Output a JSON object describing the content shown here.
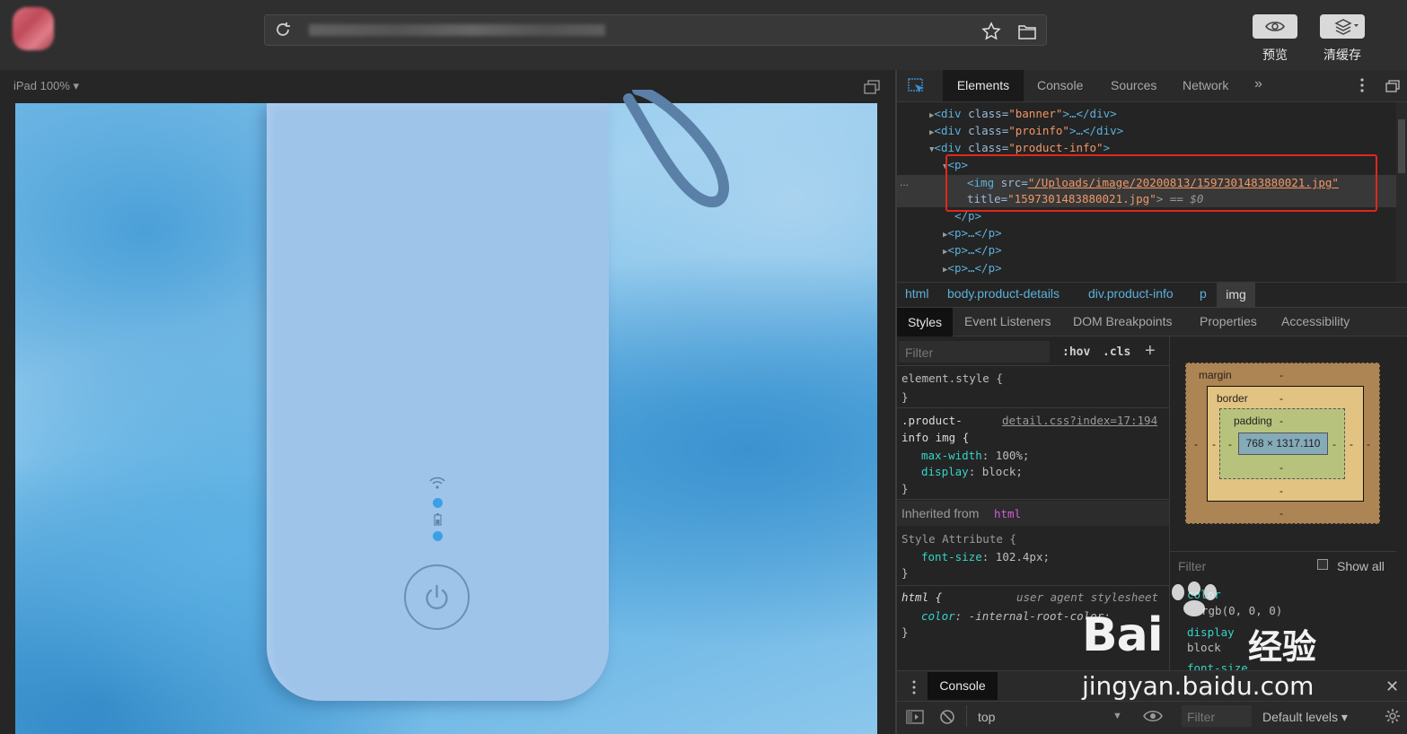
{
  "toolbar": {
    "preview_label": "预览",
    "cache_label": "清缓存"
  },
  "viewport": {
    "device_label": "iPad 100% ▾"
  },
  "devtools": {
    "tabs": [
      "Elements",
      "Console",
      "Sources",
      "Network"
    ],
    "dom": {
      "line1": {
        "tag_open": "<div ",
        "attr": "class=",
        "value": "\"banner\"",
        "rest": ">…</div>"
      },
      "line2": {
        "tag_open": "<div ",
        "attr": "class=",
        "value": "\"proinfo\"",
        "rest": ">…</div>"
      },
      "line3": {
        "tag_open": "<div ",
        "attr": "class=",
        "value": "\"product-info\"",
        "rest": ">"
      },
      "line4": "<p>",
      "line5_tag": "<img ",
      "line5_attr": "src=",
      "line5_val": "\"/Uploads/image/20200813/1597301483880021.jpg\"",
      "line6_attr": "title=",
      "line6_val": "\"1597301483880021.jpg\"",
      "line6_rest": "> == $0",
      "line7": "</p>",
      "collapsed_p": "<p>…</p>",
      "dots": "..."
    },
    "breadcrumbs": [
      "html",
      "body.product-details",
      "div.product-info",
      "p",
      "img"
    ],
    "subtabs": [
      "Styles",
      "Event Listeners",
      "DOM Breakpoints",
      "Properties",
      "Accessibility"
    ],
    "styles": {
      "filter_placeholder": "Filter",
      "hov": ":hov",
      "cls": ".cls",
      "element_style": "element.style {",
      "close_brace": "}",
      "rule_selector_1": ".product-",
      "rule_selector_2": "info img {",
      "rule_source": "detail.css?index=17:194",
      "rule_props": [
        {
          "name": "max-width",
          "value": "100%;"
        },
        {
          "name": "display",
          "value": "block;"
        }
      ],
      "inherited_label": "Inherited from",
      "inherited_tag": "html",
      "style_attr": "Style Attribute {",
      "style_attr_prop": {
        "name": "font-size",
        "value": "102.4px;"
      },
      "ua_selector": "html {",
      "ua_source": "user agent stylesheet",
      "ua_prop": {
        "name": "color",
        "value": "-internal-root-color;"
      }
    },
    "box_model": {
      "margin": "margin",
      "border": "border",
      "padding": "padding",
      "content": "768 × 1317.110",
      "dash": "-"
    },
    "computed": {
      "filter_placeholder": "Filter",
      "show_all": "Show all",
      "items": [
        "color",
        "rgb(0, 0, 0)",
        "display",
        "block",
        "font-size"
      ]
    },
    "console": {
      "tab": "Console",
      "context": "top",
      "filter_placeholder": "Filter",
      "levels": "Default levels ▾"
    }
  },
  "watermark": {
    "logo_text": "Bai",
    "logo_cn": "经验",
    "url": "jingyan.baidu.com"
  },
  "colors": {
    "selection_red": "#e0271e",
    "tag_blue": "#5db0d7",
    "attr_value_orange": "#f29766",
    "prop_teal": "#35d4c7"
  }
}
